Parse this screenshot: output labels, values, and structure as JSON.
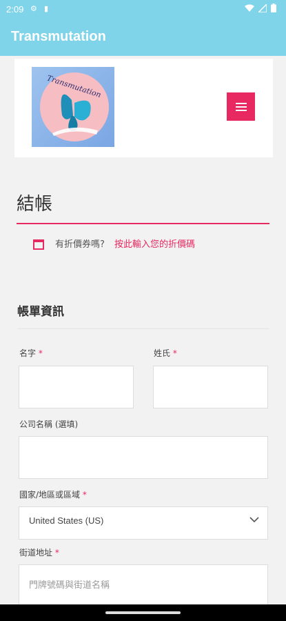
{
  "status_bar": {
    "time": "2:09",
    "icons": [
      "wifi-icon",
      "signal-icon",
      "battery-icon"
    ]
  },
  "app_bar": {
    "title": "Transmutation"
  },
  "header": {
    "logo_text": "Transmutation",
    "menu_icon": "hamburger-menu-icon"
  },
  "page": {
    "title": "結帳",
    "accent_color": "#e82860"
  },
  "coupon": {
    "question": "有折價券嗎?",
    "link": "按此輸入您的折價碼"
  },
  "billing": {
    "section_title": "帳單資訊",
    "first_name_label": "名字",
    "last_name_label": "姓氏",
    "company_label": "公司名稱 (選填)",
    "country_label": "國家/地區或區域",
    "country_value": "United States (US)",
    "street_label": "街道地址",
    "street_placeholder": "門牌號碼與街道名稱",
    "required_mark": "*"
  }
}
